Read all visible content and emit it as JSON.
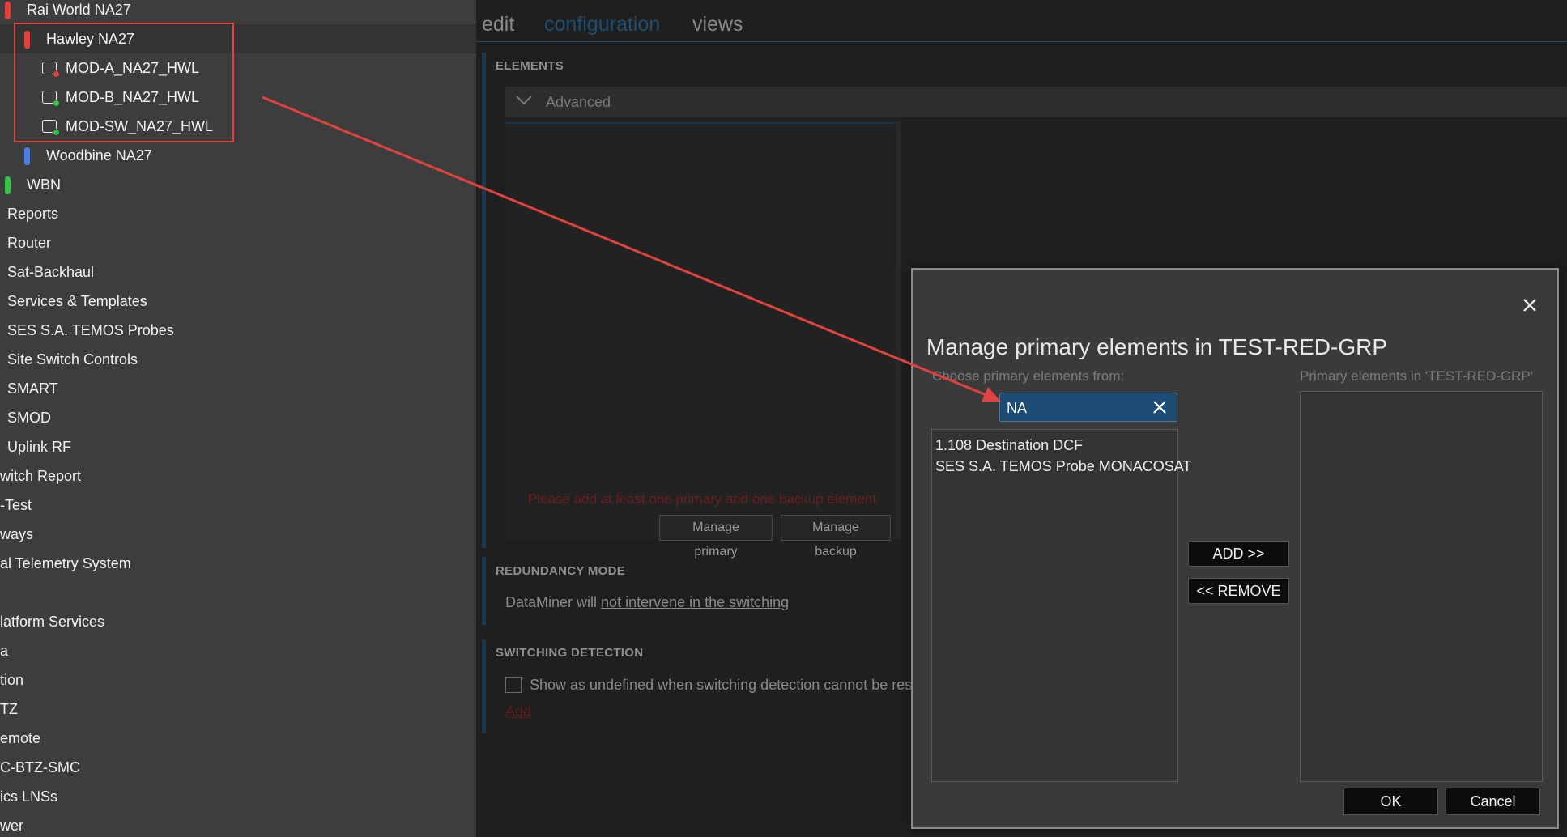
{
  "tree": {
    "items": [
      {
        "label": "Rai World NA27",
        "pill": "#e0433f"
      },
      {
        "label": "Hawley NA27",
        "pill": "#e0433f"
      },
      {
        "label": "MOD-A_NA27_HWL",
        "dot": "#e0433f"
      },
      {
        "label": "MOD-B_NA27_HWL",
        "dot": "#34c24a"
      },
      {
        "label": "MOD-SW_NA27_HWL",
        "dot": "#34c24a"
      },
      {
        "label": "Woodbine NA27",
        "pill": "#4e7fe0"
      },
      {
        "label": "WBN",
        "pill": "#34c24a"
      },
      {
        "label": "Reports"
      },
      {
        "label": "Router"
      },
      {
        "label": "Sat-Backhaul"
      },
      {
        "label": "Services & Templates"
      },
      {
        "label": "SES S.A. TEMOS Probes"
      },
      {
        "label": "Site Switch Controls"
      },
      {
        "label": "SMART"
      },
      {
        "label": "SMOD"
      },
      {
        "label": "Uplink RF"
      },
      {
        "label": "witch Report"
      },
      {
        "label": "-Test"
      },
      {
        "label": "ways"
      },
      {
        "label": "al Telemetry System"
      },
      {
        "label": ""
      },
      {
        "label": "latform Services"
      },
      {
        "label": "a"
      },
      {
        "label": "tion"
      },
      {
        "label": "TZ"
      },
      {
        "label": "emote"
      },
      {
        "label": "C-BTZ-SMC"
      },
      {
        "label": "ics LNSs"
      },
      {
        "label": "wer"
      }
    ]
  },
  "tabs": {
    "edit": "edit",
    "configuration": "configuration",
    "views": "views"
  },
  "elements": {
    "title": "ELEMENTS",
    "advanced": "Advanced",
    "warning": "Please add at least one primary and one backup element",
    "manage_primary": "Manage primary",
    "manage_backup": "Manage backup"
  },
  "redundancy": {
    "title": "REDUNDANCY MODE",
    "prefix": "DataMiner will",
    "link": "not intervene in the switching"
  },
  "switching": {
    "title": "SWITCHING DETECTION",
    "checkbox_label": "Show as undefined when switching detection cannot be res",
    "add_link": "Add"
  },
  "dialog": {
    "title": "Manage primary elements in TEST-RED-GRP",
    "choose_label": "Choose primary elements from:",
    "primary_label": "Primary elements in 'TEST-RED-GRP'",
    "search_value": "NA",
    "results": [
      "1.108 Destination DCF",
      "SES S.A. TEMOS Probe MONACOSAT"
    ],
    "add_button": "ADD >>",
    "remove_button": "<< REMOVE",
    "ok_button": "OK",
    "cancel_button": "Cancel"
  },
  "colors": {
    "annotation": "#e0433f",
    "accent": "#1c4b73"
  }
}
